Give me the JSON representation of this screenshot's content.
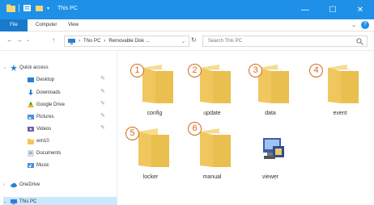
{
  "window": {
    "title": "This PC",
    "minimize": "—",
    "maximize": "☐",
    "close": "✕"
  },
  "ribbon": {
    "tabs": [
      "File",
      "Computer",
      "View"
    ],
    "expand": "⌄",
    "help": "?"
  },
  "address": {
    "back": "←",
    "forward": "→",
    "dropdown": "⌄",
    "up": "↑",
    "path": [
      "This PC",
      "Removable Disk ..."
    ],
    "path_separator": "›",
    "dropdown_arrow": "⌄",
    "refresh": "↻",
    "search_placeholder": "Search This PC"
  },
  "sidebar": {
    "items": [
      {
        "label": "Quick access",
        "icon": "star-icon",
        "pinned": false
      },
      {
        "label": "Desktop",
        "icon": "desktop-icon",
        "pinned": true
      },
      {
        "label": "Downloads",
        "icon": "download-icon",
        "pinned": true
      },
      {
        "label": "Google Drive",
        "icon": "google-drive-icon",
        "pinned": true
      },
      {
        "label": "Pictures",
        "icon": "pictures-icon",
        "pinned": true
      },
      {
        "label": "Videos",
        "icon": "videos-icon",
        "pinned": true
      },
      {
        "label": "win10",
        "icon": "folder-icon",
        "pinned": false
      },
      {
        "label": "Documents",
        "icon": "documents-icon",
        "pinned": false
      },
      {
        "label": "Music",
        "icon": "music-icon",
        "pinned": false
      },
      {
        "label": "OneDrive",
        "icon": "onedrive-icon",
        "pinned": false
      },
      {
        "label": "This PC",
        "icon": "computer-icon",
        "pinned": false
      }
    ],
    "pin_glyph": "✎",
    "expand_open": "⌄",
    "expand_closed": "›"
  },
  "main": {
    "items": [
      {
        "number": "1",
        "name": "config",
        "type": "folder"
      },
      {
        "number": "2",
        "name": "update",
        "type": "folder"
      },
      {
        "number": "3",
        "name": "data",
        "type": "folder"
      },
      {
        "number": "4",
        "name": "event",
        "type": "folder"
      },
      {
        "number": "5",
        "name": "locker",
        "type": "folder"
      },
      {
        "number": "6",
        "name": "manual",
        "type": "folder"
      },
      {
        "number": "",
        "name": "viewer",
        "type": "application"
      }
    ]
  },
  "colors": {
    "titlebar": "#1e90e8",
    "file_tab": "#1979ca",
    "folder": "#f0c75e",
    "number_circle": "#d2691e",
    "selected": "#cce8ff"
  }
}
